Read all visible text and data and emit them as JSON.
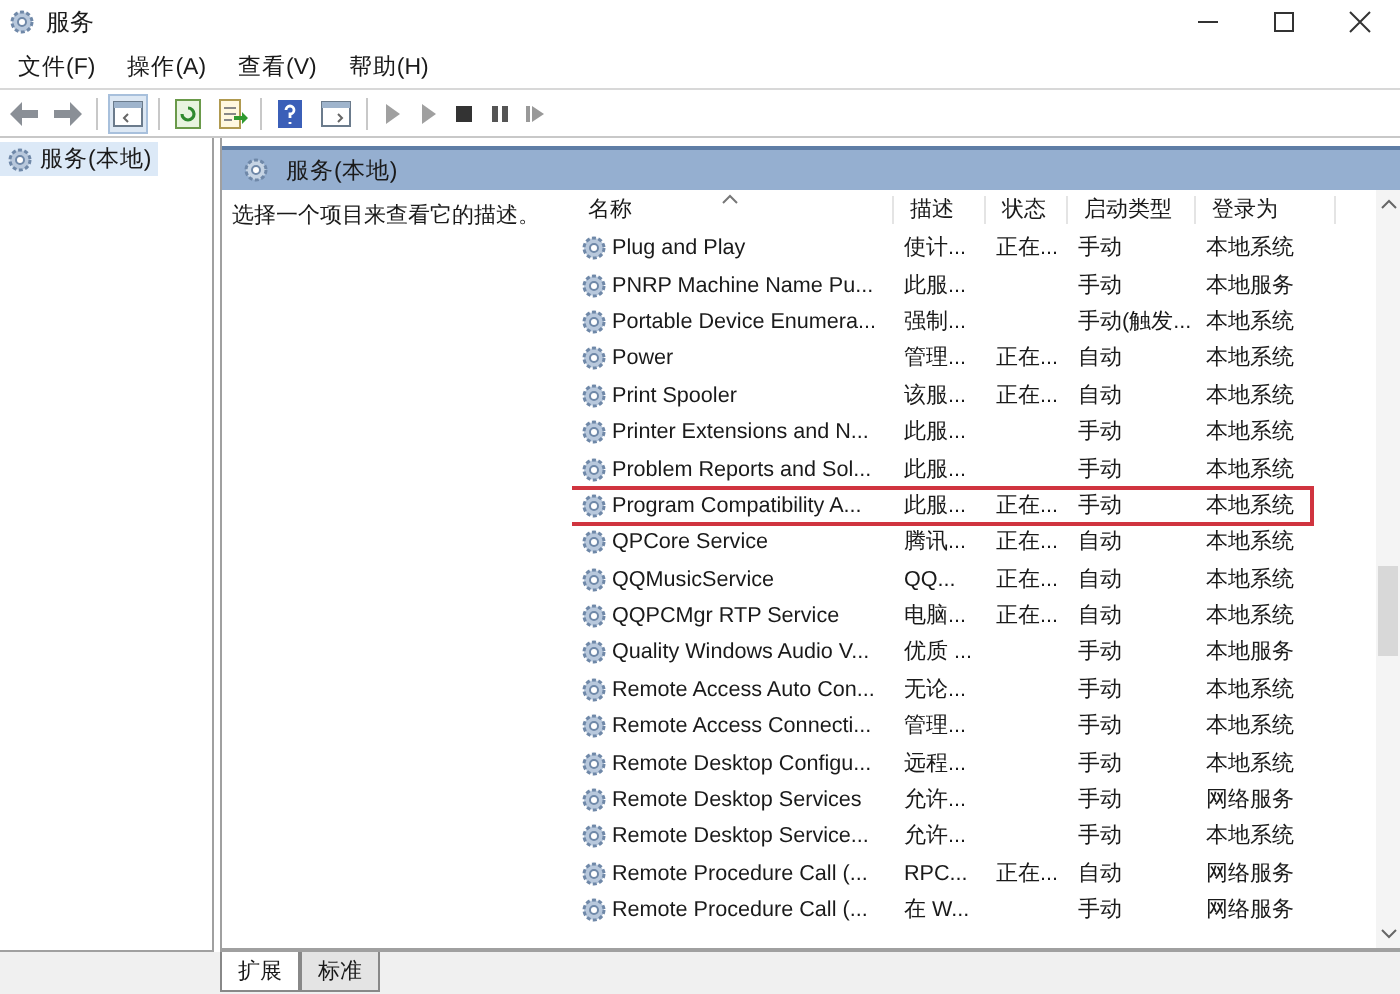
{
  "window": {
    "title": "服务"
  },
  "menu": [
    "文件(F)",
    "操作(A)",
    "查看(V)",
    "帮助(H)"
  ],
  "tree": {
    "items": [
      {
        "label": "服务(本地)",
        "selected": true
      }
    ]
  },
  "pane": {
    "title": "服务(本地)",
    "description": "选择一个项目来查看它的描述。"
  },
  "table": {
    "columns": [
      "名称",
      "描述",
      "状态",
      "启动类型",
      "登录为"
    ],
    "rows": [
      {
        "cells": [
          "Plug and Play",
          "使计...",
          "正在...",
          "手动",
          "本地系统"
        ],
        "highlighted": false
      },
      {
        "cells": [
          "PNRP Machine Name Pu...",
          "此服...",
          "",
          "手动",
          "本地服务"
        ],
        "highlighted": false
      },
      {
        "cells": [
          "Portable Device Enumera...",
          "强制...",
          "",
          "手动(触发...",
          "本地系统"
        ],
        "highlighted": false
      },
      {
        "cells": [
          "Power",
          "管理...",
          "正在...",
          "自动",
          "本地系统"
        ],
        "highlighted": false
      },
      {
        "cells": [
          "Print Spooler",
          "该服...",
          "正在...",
          "自动",
          "本地系统"
        ],
        "highlighted": false
      },
      {
        "cells": [
          "Printer Extensions and N...",
          "此服...",
          "",
          "手动",
          "本地系统"
        ],
        "highlighted": false
      },
      {
        "cells": [
          "Problem Reports and Sol...",
          "此服...",
          "",
          "手动",
          "本地系统"
        ],
        "highlighted": false
      },
      {
        "cells": [
          "Program Compatibility A...",
          "此服...",
          "正在...",
          "手动",
          "本地系统"
        ],
        "highlighted": true
      },
      {
        "cells": [
          "QPCore Service",
          "腾讯...",
          "正在...",
          "自动",
          "本地系统"
        ],
        "highlighted": false
      },
      {
        "cells": [
          "QQMusicService",
          "QQ...",
          "正在...",
          "自动",
          "本地系统"
        ],
        "highlighted": false
      },
      {
        "cells": [
          "QQPCMgr RTP Service",
          "电脑...",
          "正在...",
          "自动",
          "本地系统"
        ],
        "highlighted": false
      },
      {
        "cells": [
          "Quality Windows Audio V...",
          "优质 ...",
          "",
          "手动",
          "本地服务"
        ],
        "highlighted": false
      },
      {
        "cells": [
          "Remote Access Auto Con...",
          "无论...",
          "",
          "手动",
          "本地系统"
        ],
        "highlighted": false
      },
      {
        "cells": [
          "Remote Access Connecti...",
          "管理...",
          "",
          "手动",
          "本地系统"
        ],
        "highlighted": false
      },
      {
        "cells": [
          "Remote Desktop Configu...",
          "远程...",
          "",
          "手动",
          "本地系统"
        ],
        "highlighted": false
      },
      {
        "cells": [
          "Remote Desktop Services",
          "允许...",
          "",
          "手动",
          "网络服务"
        ],
        "highlighted": false
      },
      {
        "cells": [
          "Remote Desktop Service...",
          "允许...",
          "",
          "手动",
          "本地系统"
        ],
        "highlighted": false
      },
      {
        "cells": [
          "Remote Procedure Call (...",
          "RPC...",
          "正在...",
          "自动",
          "网络服务"
        ],
        "highlighted": false
      },
      {
        "cells": [
          "Remote Procedure Call (...",
          "在 W...",
          "",
          "手动",
          "网络服务"
        ],
        "highlighted": false
      }
    ]
  },
  "bottom_tabs": [
    {
      "label": "扩展",
      "selected": true
    },
    {
      "label": "标准",
      "selected": false
    }
  ]
}
